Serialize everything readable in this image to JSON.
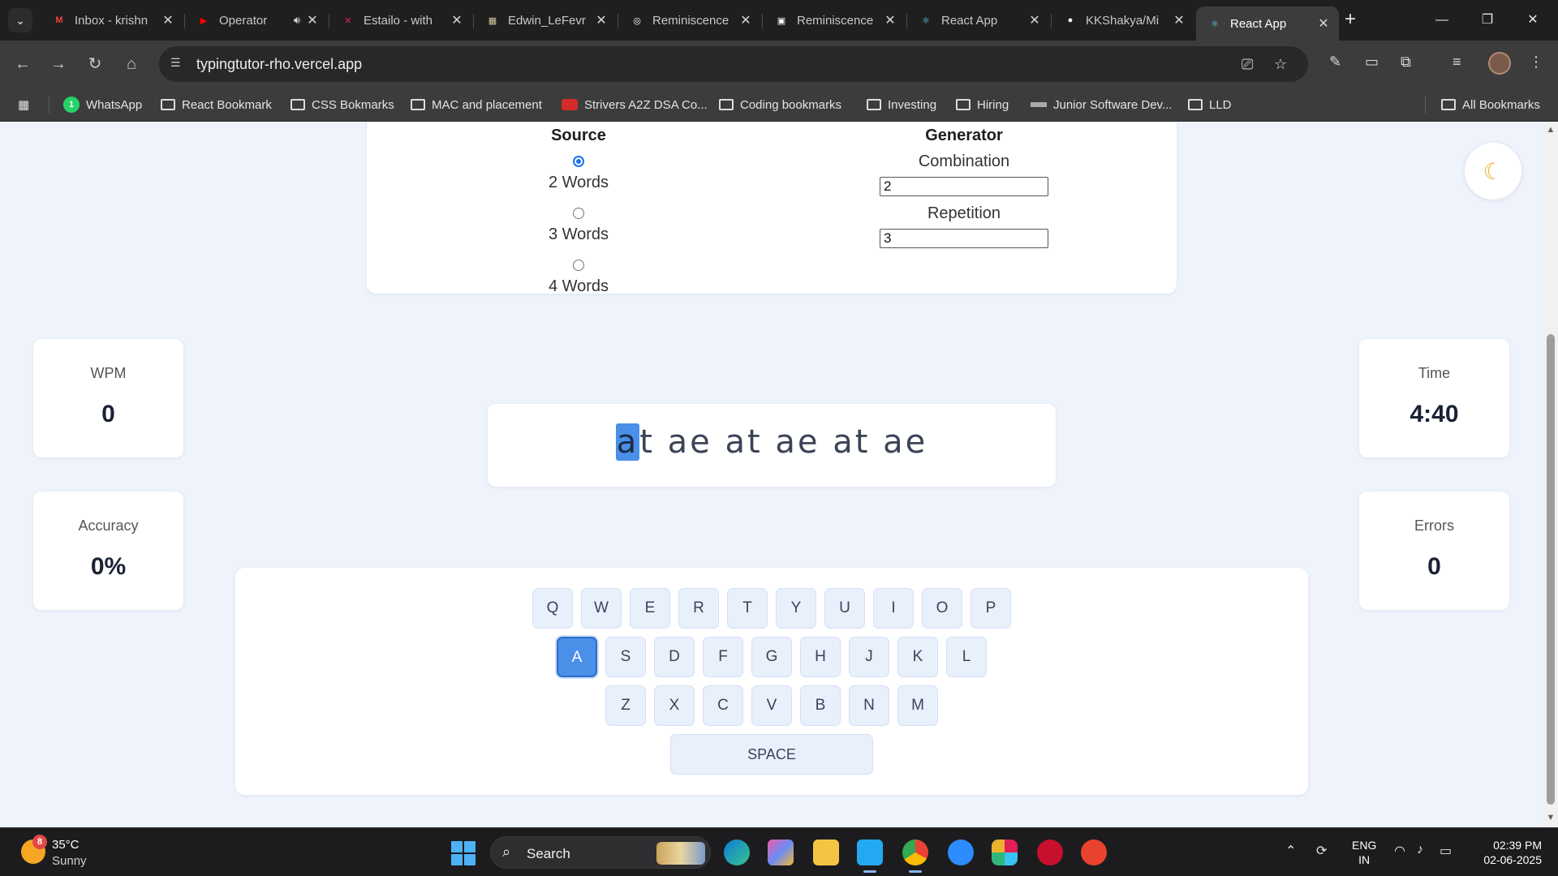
{
  "browser": {
    "tabs": [
      {
        "title": "Inbox - krishn",
        "icon": "gmail-icon",
        "color": "#ea4335",
        "glyph": "M"
      },
      {
        "title": "Operator",
        "icon": "youtube-icon",
        "color": "#ff0000",
        "glyph": "▶",
        "sound": true
      },
      {
        "title": "Estailo - with",
        "icon": "estailo-icon",
        "color": "#e0245e",
        "glyph": "✕"
      },
      {
        "title": "Edwin_LeFevr",
        "icon": "document-icon",
        "color": "#d8c9a0",
        "glyph": "▦"
      },
      {
        "title": "Reminiscence",
        "icon": "openai-icon",
        "color": "#ffffff",
        "glyph": "◎"
      },
      {
        "title": "Reminiscence",
        "icon": "book-icon",
        "color": "#ffffff",
        "glyph": "▣"
      },
      {
        "title": "React App",
        "icon": "react-icon",
        "color": "#61dafb",
        "glyph": "⚛"
      },
      {
        "title": "KKShakya/Mi",
        "icon": "github-icon",
        "color": "#ffffff",
        "glyph": "●"
      },
      {
        "title": "React App",
        "icon": "react-icon",
        "color": "#61dafb",
        "glyph": "⚛",
        "active": true
      }
    ],
    "url": "typingtutor-rho.vercel.app",
    "bookmarks": [
      {
        "label": "WhatsApp",
        "type": "wa"
      },
      {
        "label": "React Bookmark",
        "type": "folder"
      },
      {
        "label": "CSS Bokmarks",
        "type": "folder"
      },
      {
        "label": "MAC and placement",
        "type": "folder"
      },
      {
        "label": "Strivers A2Z DSA Co...",
        "type": "tuf"
      },
      {
        "label": "Coding bookmarks",
        "type": "folder"
      },
      {
        "label": "Investing",
        "type": "folder"
      },
      {
        "label": "Hiring",
        "type": "folder"
      },
      {
        "label": "Junior Software Dev...",
        "type": "dash"
      },
      {
        "label": "LLD",
        "type": "folder"
      }
    ],
    "all_bookmarks": "All Bookmarks"
  },
  "settings": {
    "source": {
      "heading": "Source",
      "options": [
        {
          "label": "2 Words",
          "checked": true
        },
        {
          "label": "3 Words",
          "checked": false
        },
        {
          "label": "4 Words",
          "checked": false
        }
      ]
    },
    "generator": {
      "heading": "Generator",
      "combination_label": "Combination",
      "combination_value": "2",
      "repetition_label": "Repetition",
      "repetition_value": "3"
    }
  },
  "theme_toggle_icon": "moon-icon",
  "stats": {
    "wpm": {
      "label": "WPM",
      "value": "0"
    },
    "accuracy": {
      "label": "Accuracy",
      "value": "0%"
    },
    "time": {
      "label": "Time",
      "value": "4:40"
    },
    "errors": {
      "label": "Errors",
      "value": "0"
    }
  },
  "typing": {
    "current_char": "a",
    "rest": "t ae at ae at ae"
  },
  "keyboard": {
    "row1": [
      "Q",
      "W",
      "E",
      "R",
      "T",
      "Y",
      "U",
      "I",
      "O",
      "P"
    ],
    "row2": [
      "A",
      "S",
      "D",
      "F",
      "G",
      "H",
      "J",
      "K",
      "L"
    ],
    "row3": [
      "Z",
      "X",
      "C",
      "V",
      "B",
      "N",
      "M"
    ],
    "space": "SPACE",
    "active_key": "A"
  },
  "taskbar": {
    "weather_badge": "8",
    "temperature": "35°C",
    "condition": "Sunny",
    "search": "Search",
    "lang_top": "ENG",
    "lang_bottom": "IN",
    "time": "02:39 PM",
    "date": "02-06-2025"
  },
  "colors": {
    "accent": "#4a8fe8",
    "page_bg": "#eef3fc"
  }
}
